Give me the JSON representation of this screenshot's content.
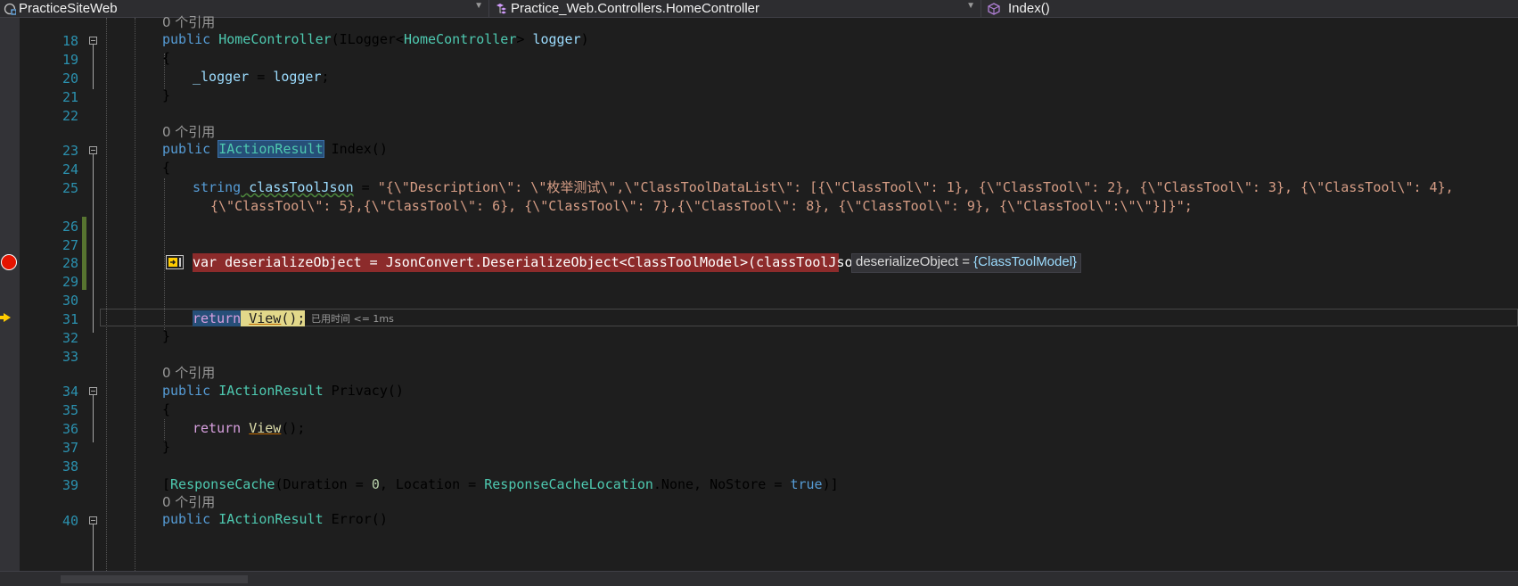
{
  "navbar": {
    "project": "PracticeSiteWeb",
    "class": "Practice_Web.Controllers.HomeController",
    "member": "Index()"
  },
  "refs": "0 个引用",
  "lines": {
    "n18": "18",
    "n19": "19",
    "n20": "20",
    "n21": "21",
    "n22": "22",
    "n23": "23",
    "n24": "24",
    "n25": "25",
    "n26": "26",
    "n27": "27",
    "n28": "28",
    "n29": "29",
    "n30": "30",
    "n31": "31",
    "n32": "32",
    "n33": "33",
    "n34": "34",
    "n35": "35",
    "n36": "36",
    "n37": "37",
    "n38": "38",
    "n39": "39",
    "n40": "40"
  },
  "code": {
    "kw_public": "public",
    "ctor_name": "HomeController",
    "ctor_params_open": "(ILogger<",
    "ctor_type": "HomeController",
    "ctor_params_close": "> ",
    "ctor_param": "logger",
    "ctor_end": ")",
    "brace_open": "{",
    "brace_close": "}",
    "assign_field": "_logger",
    "assign_eq": " = ",
    "assign_val": "logger",
    "semicolon": ";",
    "type_iaction": "IActionResult",
    "index_sig": " Index()",
    "kw_string": "string",
    "var_classtool": " classToolJson",
    "eq": " = ",
    "json_line1": "\"{\\\"Description\\\": \\\"枚举测试\\\",\\\"ClassToolDataList\\\": [{\\\"ClassTool\\\": 1}, {\\\"ClassTool\\\": 2}, {\\\"ClassTool\\\": 3}, {\\\"ClassTool\\\": 4},",
    "json_line2": "{\\\"ClassTool\\\": 5},{\\\"ClassTool\\\": 6}, {\\\"ClassTool\\\": 7},{\\\"ClassTool\\\": 8}, {\\\"ClassTool\\\": 9}, {\\\"ClassTool\\\":\\\"\\\"}]}\";",
    "line28": "var deserializeObject = JsonConvert.DeserializeObject<ClassToolModel>(classToolJson);",
    "kw_return": "return",
    "view_call": "View",
    "call_end": "();",
    "privacy_sig": " Privacy()",
    "attr_open": "[",
    "attr_name": "ResponseCache",
    "attr_args1": "(Duration = ",
    "attr_num": "0",
    "attr_args2": ", Location = ",
    "attr_enum": "ResponseCacheLocation",
    "attr_args3": ".None, NoStore = ",
    "attr_true": "true",
    "attr_close": ")]",
    "error_sig": " Error()"
  },
  "datatip": {
    "name": "deserializeObject = ",
    "value": "{ClassToolModel}"
  },
  "perf_tip": "已用时间 <= 1ms",
  "colors": {
    "background": "#1e1e1e",
    "breakpoint": "#e51400",
    "exec_arrow": "#ffcc00",
    "line_number": "#2b91af"
  }
}
